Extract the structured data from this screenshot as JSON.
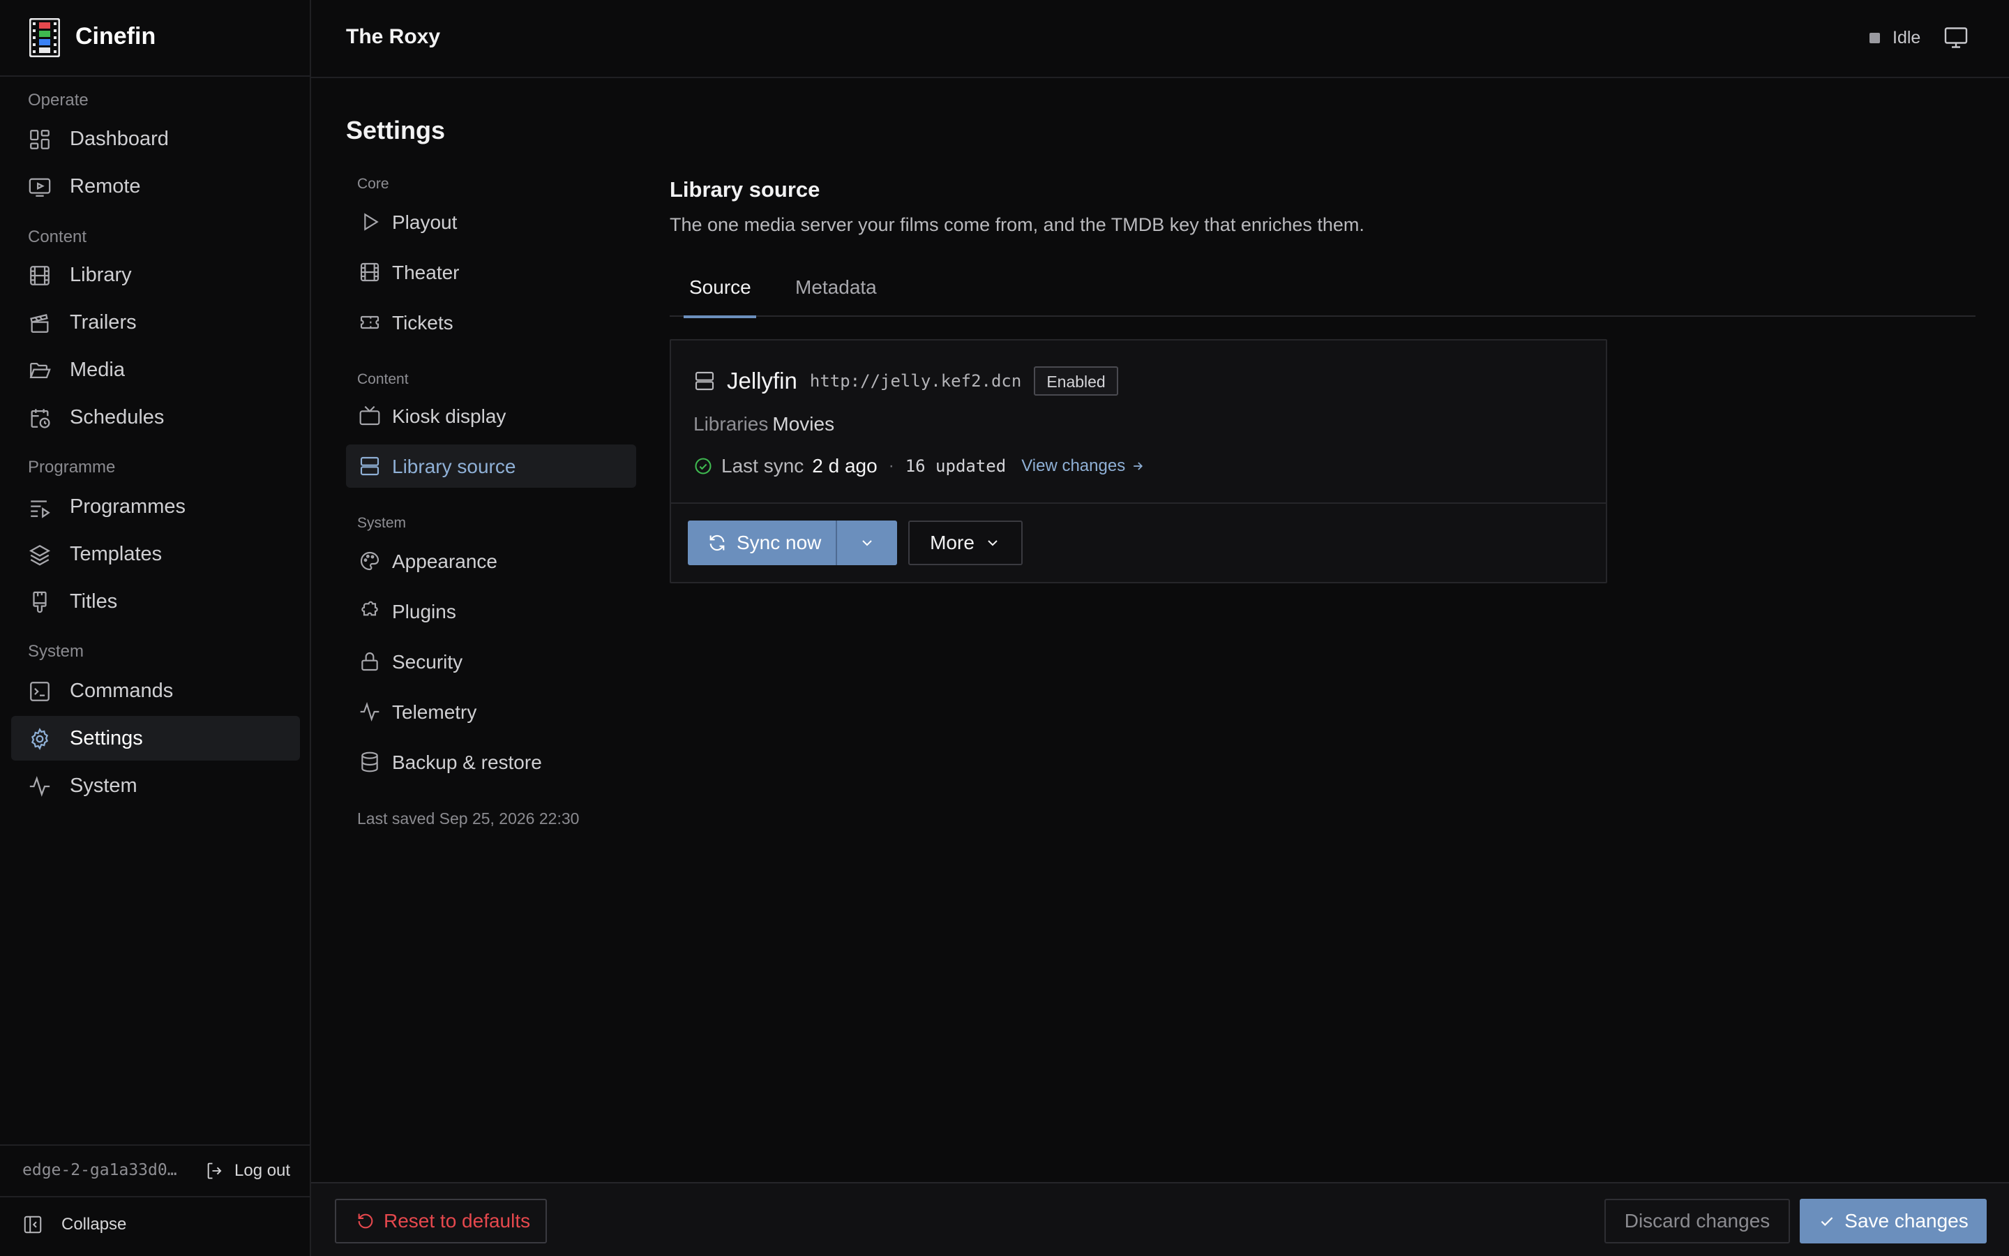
{
  "brand": {
    "name": "Cinefin"
  },
  "header": {
    "venue": "The Roxy",
    "status": "Idle"
  },
  "sidebar": {
    "sections": [
      {
        "label": "Operate",
        "items": [
          {
            "label": "Dashboard",
            "icon": "dashboard-icon"
          },
          {
            "label": "Remote",
            "icon": "remote-icon"
          }
        ]
      },
      {
        "label": "Content",
        "items": [
          {
            "label": "Library",
            "icon": "film-icon"
          },
          {
            "label": "Trailers",
            "icon": "clapperboard-icon"
          },
          {
            "label": "Media",
            "icon": "folder-open-icon"
          },
          {
            "label": "Schedules",
            "icon": "calendar-clock-icon"
          }
        ]
      },
      {
        "label": "Programme",
        "items": [
          {
            "label": "Programmes",
            "icon": "list-play-icon"
          },
          {
            "label": "Templates",
            "icon": "layers-icon"
          },
          {
            "label": "Titles",
            "icon": "brush-icon"
          }
        ]
      },
      {
        "label": "System",
        "items": [
          {
            "label": "Commands",
            "icon": "terminal-icon"
          },
          {
            "label": "Settings",
            "icon": "gear-icon",
            "active": true
          },
          {
            "label": "System",
            "icon": "activity-icon"
          }
        ]
      }
    ],
    "footer": {
      "node": "edge-2-ga1a33d0…",
      "logout": "Log out",
      "collapse": "Collapse"
    }
  },
  "page": {
    "title": "Settings",
    "last_saved": "Last saved Sep 25, 2026 22:30"
  },
  "subnav": {
    "sections": [
      {
        "label": "Core",
        "items": [
          {
            "label": "Playout"
          },
          {
            "label": "Theater"
          },
          {
            "label": "Tickets"
          }
        ]
      },
      {
        "label": "Content",
        "items": [
          {
            "label": "Kiosk display"
          },
          {
            "label": "Library source",
            "active": true
          }
        ]
      },
      {
        "label": "System",
        "items": [
          {
            "label": "Appearance"
          },
          {
            "label": "Plugins"
          },
          {
            "label": "Security"
          },
          {
            "label": "Telemetry"
          },
          {
            "label": "Backup & restore"
          }
        ]
      }
    ]
  },
  "content": {
    "title": "Library source",
    "description": "The one media server your films come from, and the TMDB key that enriches them.",
    "tabs": [
      {
        "label": "Source",
        "active": true
      },
      {
        "label": "Metadata"
      }
    ],
    "server": {
      "name": "Jellyfin",
      "url": "http://jelly.kef2.dcn",
      "badge": "Enabled",
      "libraries_label": "Libraries",
      "libraries_value": "Movies",
      "last_sync_label": "Last sync",
      "last_sync_value": "2 d ago",
      "separator": "·",
      "updated": "16 updated",
      "view_changes": "View changes"
    },
    "actions": {
      "sync_now": "Sync now",
      "more": "More"
    }
  },
  "actionbar": {
    "reset": "Reset to defaults",
    "discard": "Discard changes",
    "save": "Save changes"
  },
  "colors": {
    "accent": "#6b8fbd",
    "accent_text": "#8fb0d6",
    "danger": "#e5484d",
    "success": "#3fb950"
  }
}
